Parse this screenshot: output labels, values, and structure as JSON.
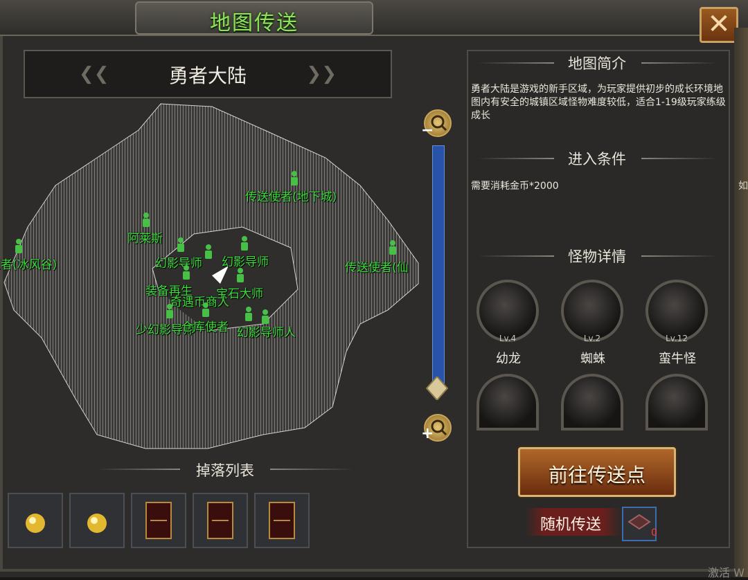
{
  "window": {
    "title": "地图传送",
    "close_glyph": "✕"
  },
  "map": {
    "name": "勇者大陆",
    "npcs": [
      {
        "label": "传送使者(地下城)"
      },
      {
        "label": "阿莱斯"
      },
      {
        "label": "王者(冰风谷)"
      },
      {
        "label": "传送使者(仙"
      },
      {
        "label": "幻影导师"
      },
      {
        "label": "幻影导师"
      },
      {
        "label": "装备再生"
      },
      {
        "label": "宝石大师"
      },
      {
        "label": "奇遇币商人"
      },
      {
        "label": "少幻影导师"
      },
      {
        "label": "仓库使者"
      },
      {
        "label": "幻影导师人"
      }
    ]
  },
  "drops": {
    "title": "掉落列表",
    "items": [
      {
        "icon": "gold-orb"
      },
      {
        "icon": "gold-orb"
      },
      {
        "icon": "book"
      },
      {
        "icon": "book"
      },
      {
        "icon": "book"
      }
    ]
  },
  "info": {
    "intro_title": "地图简介",
    "intro_text": "勇者大陆是游戏的新手区域，为玩家提供初步的成长环境地图内有安全的城镇区域怪物难度较低，适合1-19级玩家练级成长",
    "cond_title": "进入条件",
    "cond_text": "需要消耗金币*2000",
    "monster_title": "怪物详情",
    "monsters": [
      {
        "name": "幼龙",
        "level": "Lv.4"
      },
      {
        "name": "蜘蛛",
        "level": "Lv.2"
      },
      {
        "name": "蛮牛怪",
        "level": "Lv.12"
      },
      {
        "name": "",
        "level": ""
      },
      {
        "name": "",
        "level": ""
      },
      {
        "name": "",
        "level": ""
      }
    ]
  },
  "actions": {
    "go_label": "前往传送点",
    "random_label": "随机传送",
    "random_count": "0"
  },
  "misc": {
    "corner_text": "激活 W",
    "edge_text": "如"
  }
}
